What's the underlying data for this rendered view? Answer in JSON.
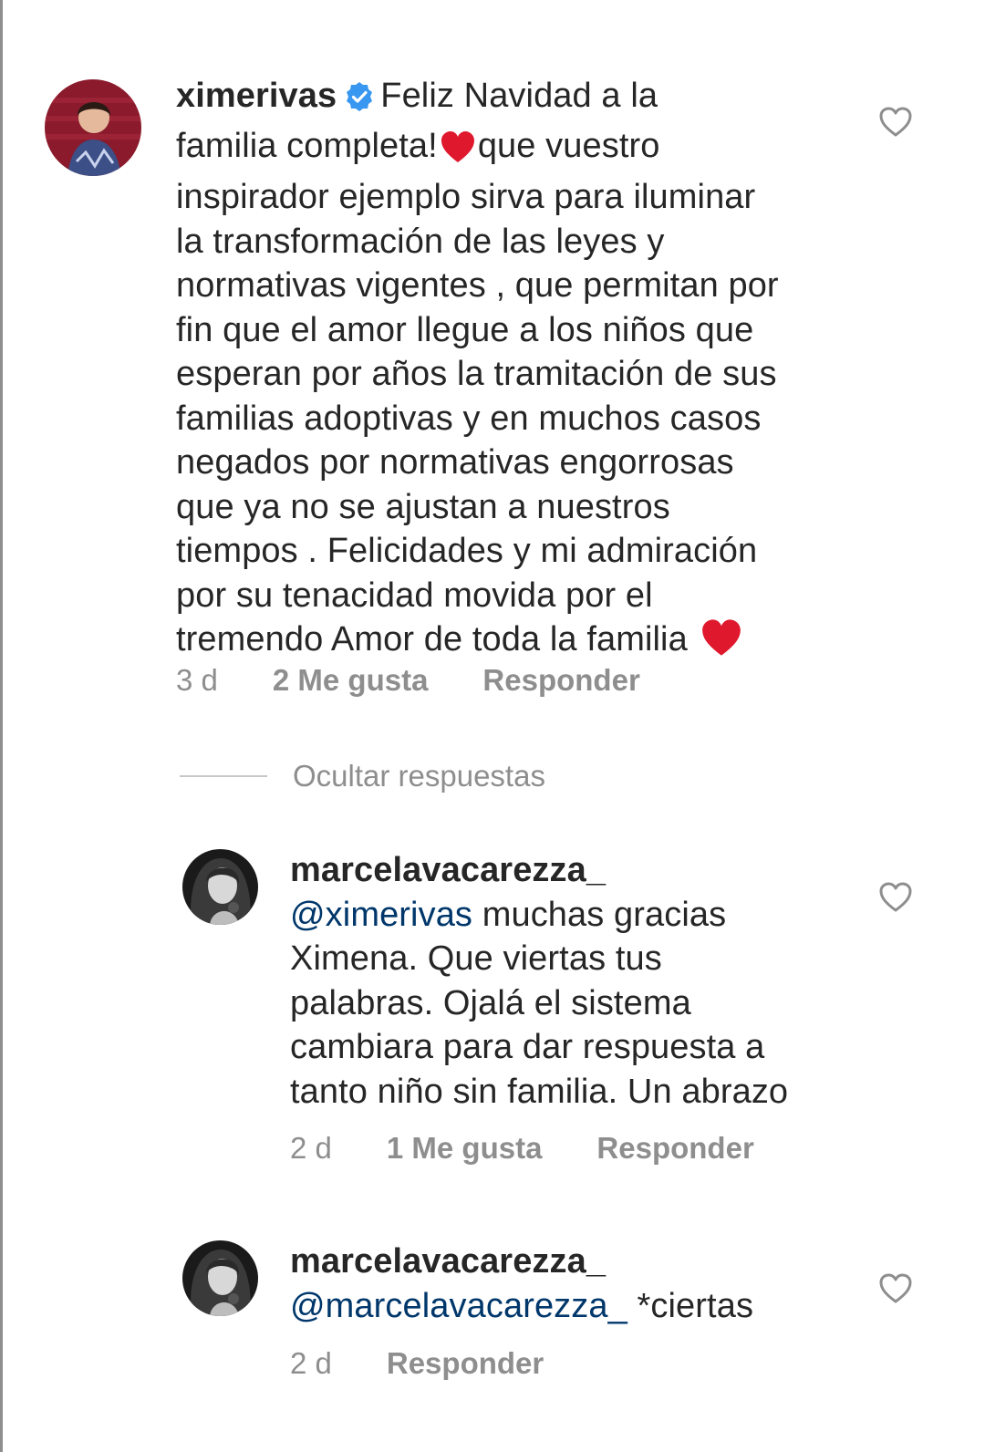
{
  "comments": [
    {
      "username": "ximerivas",
      "verified": true,
      "text_lines": [
        "Feliz Navidad a la",
        "familia completa!",
        "que vuestro",
        "inspirador ejemplo sirva para iluminar",
        "la transformación de las leyes y",
        "normativas vigentes , que permitan por",
        "fin que el amor llegue a los niños que",
        "esperan por años la tramitación de sus",
        "familias adoptivas y en muchos casos",
        "negados por normativas engorrosas",
        "que ya no se ajustan a nuestros",
        "tiempos . Felicidades y mi admiración",
        "por su tenacidad movida por el",
        "tremendo Amor de toda la familia"
      ],
      "time": "3 d",
      "likes": "2 Me gusta",
      "reply": "Responder"
    },
    {
      "username": "marcelavacarezza_",
      "mention": "@ximerivas",
      "text_lines": [
        "muchas gracias",
        "Ximena. Que viertas tus",
        "palabras. Ojalá el sistema",
        "cambiara para dar respuesta a",
        "tanto niño sin familia. Un abrazo"
      ],
      "time": "2 d",
      "likes": "1 Me gusta",
      "reply": "Responder"
    },
    {
      "username": "marcelavacarezza_",
      "mention": "@marcelavacarezza_",
      "text_lines": [
        "*ciertas"
      ],
      "time": "2 d",
      "reply": "Responder"
    }
  ],
  "hide_replies": "Ocultar respuestas",
  "icons": {
    "like": "heart-outline-icon",
    "verified": "verified-badge-icon",
    "emoji": "red-heart-emoji"
  },
  "colors": {
    "text": "#262626",
    "secondary": "#8e8e8e",
    "mention": "#00376b",
    "verified": "#3897f0",
    "emoji_heart": "#e0182d"
  }
}
